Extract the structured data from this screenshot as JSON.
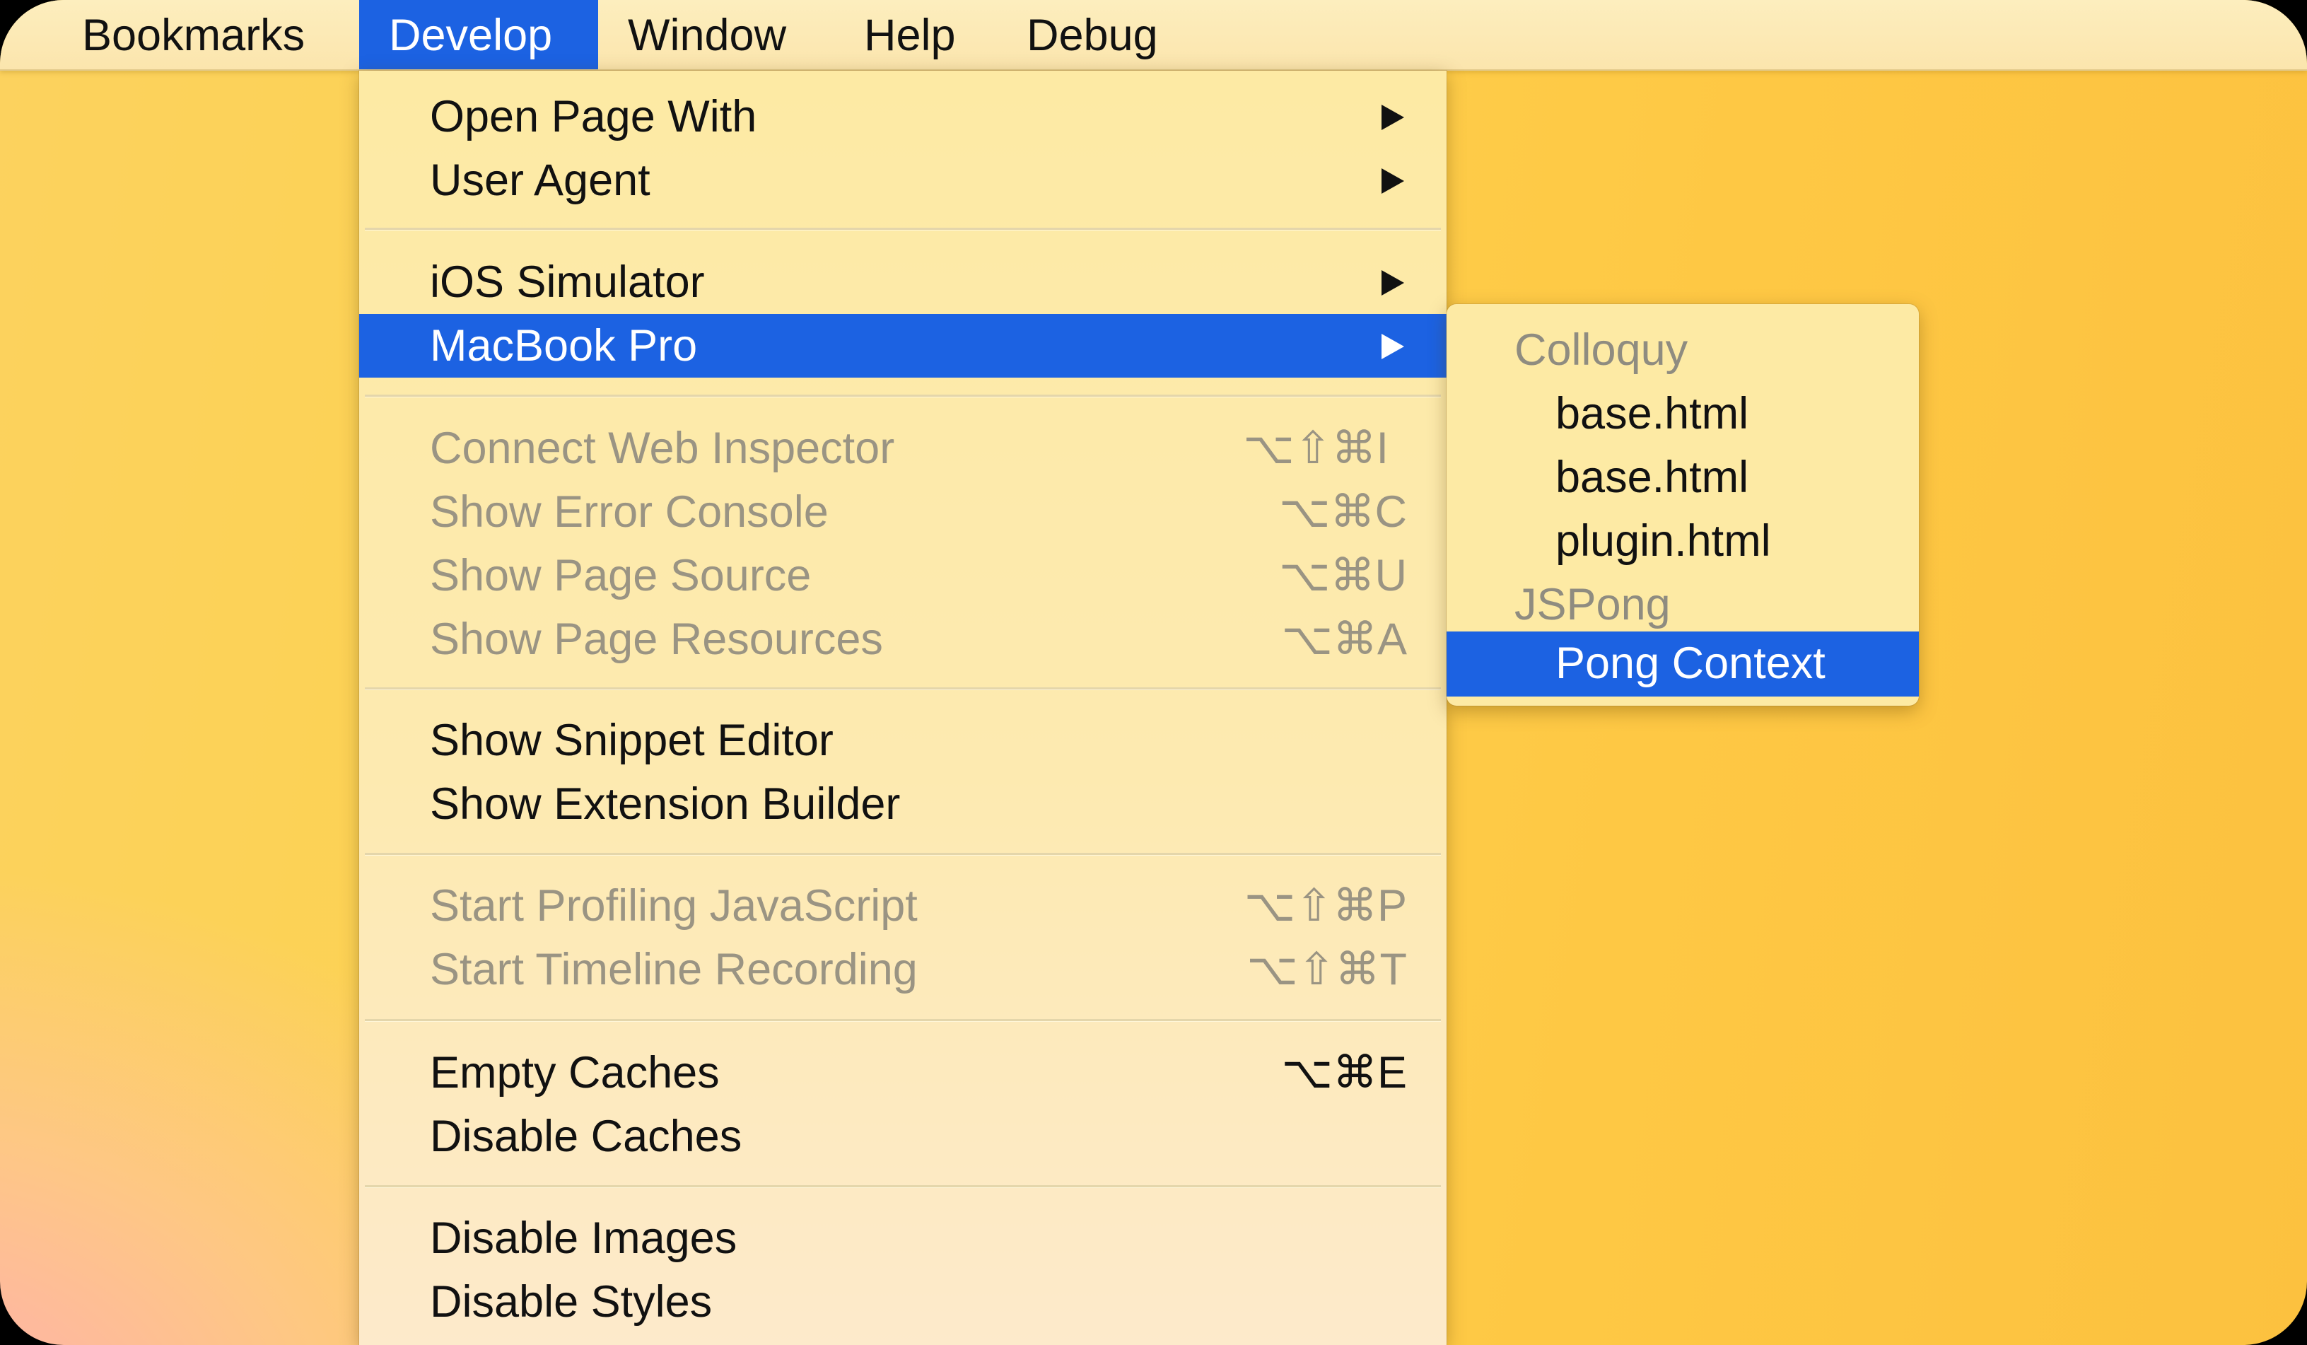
{
  "menubar": {
    "items": [
      {
        "label": "Bookmarks",
        "active": false
      },
      {
        "label": "Develop",
        "active": true
      },
      {
        "label": "Window",
        "active": false
      },
      {
        "label": "Help",
        "active": false
      },
      {
        "label": "Debug",
        "active": false
      }
    ]
  },
  "develop_menu": {
    "items": [
      {
        "label": "Open Page With",
        "submenu": true,
        "enabled": true
      },
      {
        "label": "User Agent",
        "submenu": true,
        "enabled": true
      },
      {
        "label": "iOS Simulator",
        "submenu": true,
        "enabled": true
      },
      {
        "label": "MacBook Pro",
        "submenu": true,
        "enabled": true,
        "highlighted": true
      },
      {
        "label": "Connect Web Inspector",
        "shortcut": "⌥⇧⌘I",
        "enabled": false
      },
      {
        "label": "Show Error Console",
        "shortcut": "⌥⌘C",
        "enabled": false
      },
      {
        "label": "Show Page Source",
        "shortcut": "⌥⌘U",
        "enabled": false
      },
      {
        "label": "Show Page Resources",
        "shortcut": "⌥⌘A",
        "enabled": false
      },
      {
        "label": "Show Snippet Editor",
        "enabled": true
      },
      {
        "label": "Show Extension Builder",
        "enabled": true
      },
      {
        "label": "Start Profiling JavaScript",
        "shortcut": "⌥⇧⌘P",
        "enabled": false
      },
      {
        "label": "Start Timeline Recording",
        "shortcut": "⌥⇧⌘T",
        "enabled": false
      },
      {
        "label": "Empty Caches",
        "shortcut": "⌥⌘E",
        "enabled": true
      },
      {
        "label": "Disable Caches",
        "enabled": true
      },
      {
        "label": "Disable Images",
        "enabled": true
      },
      {
        "label": "Disable Styles",
        "enabled": true
      }
    ]
  },
  "submenu": {
    "items": [
      {
        "label": "Colloquy",
        "type": "group"
      },
      {
        "label": "base.html",
        "type": "child"
      },
      {
        "label": "base.html",
        "type": "child"
      },
      {
        "label": "plugin.html",
        "type": "child"
      },
      {
        "label": "JSPong",
        "type": "group"
      },
      {
        "label": "Pong Context",
        "type": "child",
        "highlighted": true
      }
    ]
  },
  "colors": {
    "highlight": "#1c62e2",
    "menu_background": "#fdeaa4",
    "disabled_text": "#9a9483"
  }
}
